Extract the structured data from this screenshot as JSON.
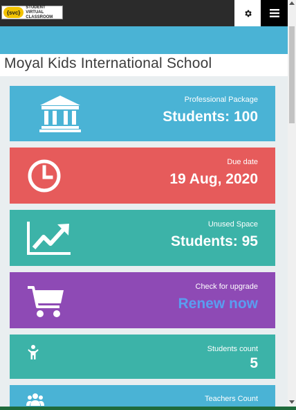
{
  "header": {
    "logo_mark": "{svc}",
    "logo_text": "STUDENT VIRTUAL CLASSROOM",
    "settings_icon": "gear-icon",
    "menu_icon": "hamburger-menu-icon"
  },
  "school": {
    "name": "Moyal Kids International School"
  },
  "cards": [
    {
      "label": "Professional Package",
      "value": "Students: 100",
      "color": "#4ab3d5",
      "icon": "bank-building-icon"
    },
    {
      "label": "Due date",
      "value": "19 Aug, 2020",
      "color": "#e65b5b",
      "icon": "clock-icon"
    },
    {
      "label": "Unused Space",
      "value": "Students: 95",
      "color": "#3cb3a8",
      "icon": "trending-up-chart-icon"
    },
    {
      "label": "Check for upgrade",
      "value": "Renew now",
      "color": "#8e4ab5",
      "link_color": "#5a9df0",
      "icon": "shopping-cart-icon"
    },
    {
      "label": "Students count",
      "value": "5",
      "color": "#3cb3a8",
      "icon": "student-figure-icon"
    },
    {
      "label": "Teachers Count",
      "value": "",
      "color": "#4ab3d5",
      "icon": "group-users-icon"
    }
  ]
}
